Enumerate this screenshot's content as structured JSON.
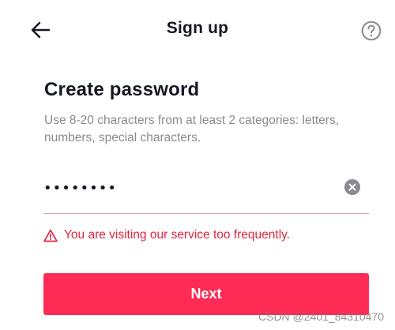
{
  "header": {
    "title": "Sign up",
    "back_icon": "arrow-left-icon",
    "help_icon": "question-circle-icon"
  },
  "main": {
    "title": "Create password",
    "subtitle": "Use 8-20 characters from at least 2 categories: letters, numbers, special characters.",
    "password": {
      "value": "••••••••",
      "clear_icon": "clear-x-icon"
    },
    "error": {
      "icon": "warning-triangle-icon",
      "text": "You are visiting our service too frequently."
    },
    "next_button": {
      "label": "Next"
    }
  },
  "watermark": "CSDN @2401_84310470",
  "colors": {
    "accent": "#fe2c55",
    "error": "#e0243f",
    "text": "#161823",
    "secondary_text": "#8a8b91",
    "icon_gray": "#8a8b91"
  }
}
